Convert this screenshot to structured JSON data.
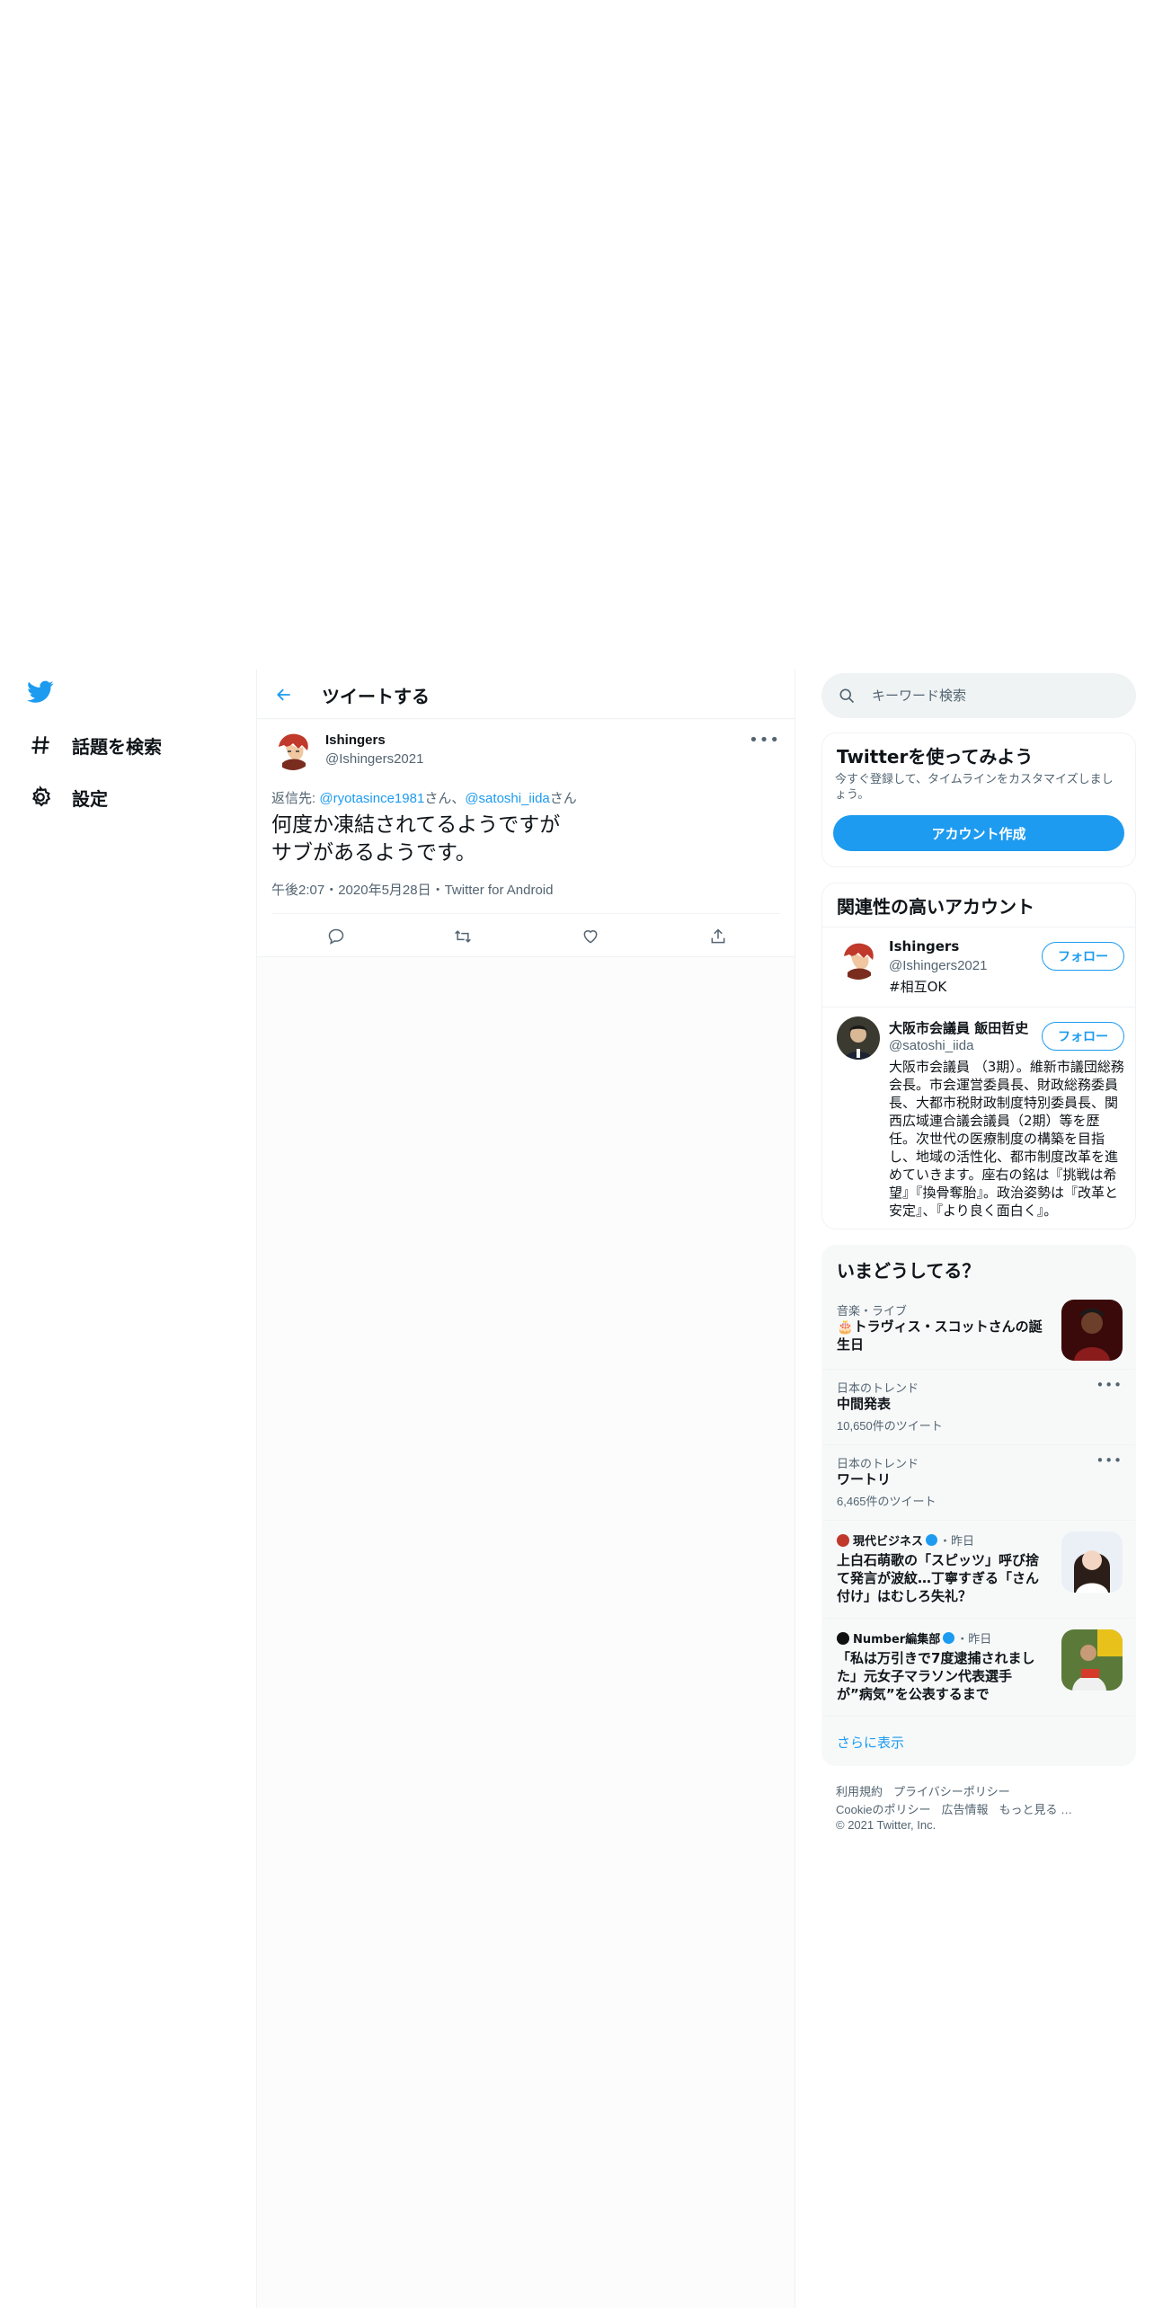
{
  "nav": {
    "items": [
      {
        "label": "話題を検索",
        "icon": "hashtag-icon"
      },
      {
        "label": "設定",
        "icon": "gear-icon"
      }
    ]
  },
  "header": {
    "title": "ツイートする"
  },
  "tweet": {
    "name": "Ishingers",
    "handle": "@Ishingers2021",
    "reply_prefix": "返信先: ",
    "reply_user1": "@ryotasince1981",
    "reply_sep1": "さん、",
    "reply_user2": "@satoshi_iida",
    "reply_sep2": "さん",
    "text": "何度か凍結されてるようですが\nサブがあるようです。",
    "meta": "午後2:07・2020年5月28日・Twitter for Android"
  },
  "search": {
    "placeholder": "キーワード検索"
  },
  "signup": {
    "title": "Twitterを使ってみよう",
    "desc": "今すぐ登録して、タイムラインをカスタマイズしましょう。",
    "button": "アカウント作成"
  },
  "relevant": {
    "title": "関連性の高いアカウント",
    "follow_label": "フォロー",
    "accounts": [
      {
        "name": "Ishingers",
        "handle": "@Ishingers2021",
        "bio": "#相互OK"
      },
      {
        "name": "大阪市会議員 飯田哲史",
        "handle": "@satoshi_iida",
        "bio": "大阪市会議員 （3期）。維新市議団総務会長。市会運営委員長、財政総務委員長、大都市税財政制度特別委員長、関西広域連合議会議員（2期）等を歴任。次世代の医療制度の構築を目指し、地域の活性化、都市制度改革を進めていきます。座右の銘は『挑戦は希望』『換骨奪胎』。政治姿勢は『改革と安定』、『より良く面白く』。"
      }
    ]
  },
  "trends": {
    "title": "いまどうしてる？",
    "items": [
      {
        "context": "音楽・ライブ",
        "title": "🎂トラヴィス・スコットさんの誕生日"
      },
      {
        "context": "日本のトレンド",
        "title": "中間発表",
        "count": "10,650件のツイート"
      },
      {
        "context": "日本のトレンド",
        "title": "ワートリ",
        "count": "6,465件のツイート"
      },
      {
        "source": "現代ビジネス",
        "time": "・昨日",
        "title": "上白石萌歌の「スピッツ」呼び捨て発言が波紋…丁寧すぎる「さん付け」はむしろ失礼？"
      },
      {
        "source": "Number編集部",
        "time": "・昨日",
        "title": "「私は万引きで7度逮捕されました」元女子マラソン代表選手が”病気”を公表するまで"
      }
    ],
    "show_more": "さらに表示"
  },
  "footer": {
    "terms": "利用規約",
    "privacy": "プライバシーポリシー",
    "cookie": "Cookieのポリシー",
    "ads": "広告情報",
    "more": "もっと見る …",
    "copyright": "© 2021 Twitter, Inc."
  },
  "colors": {
    "accent": "#1d9bf0",
    "text": "#0f1419",
    "muted": "#536471",
    "border": "#eff3f4"
  }
}
